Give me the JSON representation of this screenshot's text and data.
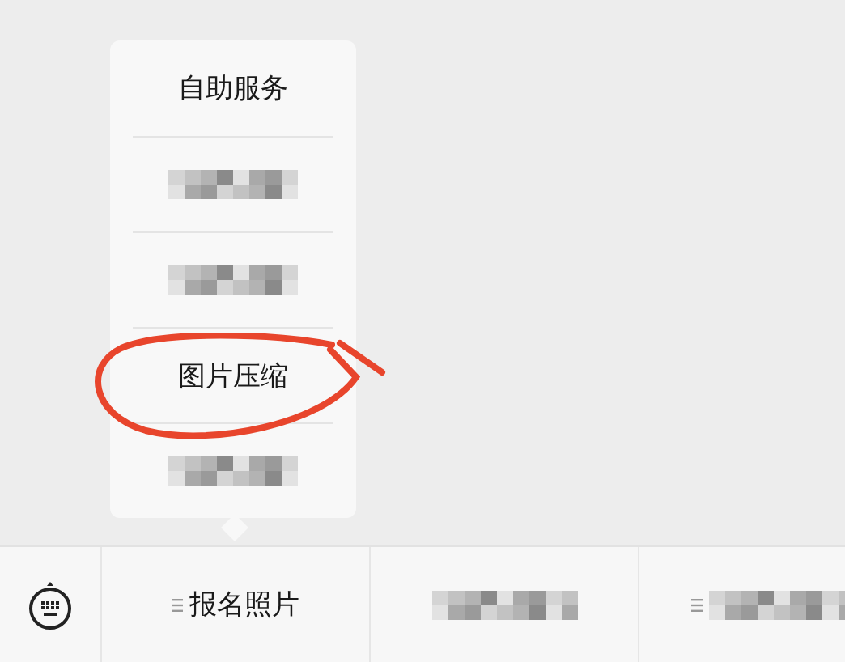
{
  "popup_menu": {
    "items": [
      {
        "kind": "text",
        "label": "自助服务"
      },
      {
        "kind": "obscured"
      },
      {
        "kind": "obscured"
      },
      {
        "kind": "text",
        "label": "图片压缩"
      },
      {
        "kind": "obscured"
      }
    ]
  },
  "annotation": {
    "kind": "freehand_circle"
  },
  "menu_bar": {
    "tabs": [
      {
        "kind": "text",
        "label": "报名照片",
        "submenu": true
      },
      {
        "kind": "obscured",
        "submenu": false
      },
      {
        "kind": "obscured",
        "submenu": true
      }
    ]
  }
}
